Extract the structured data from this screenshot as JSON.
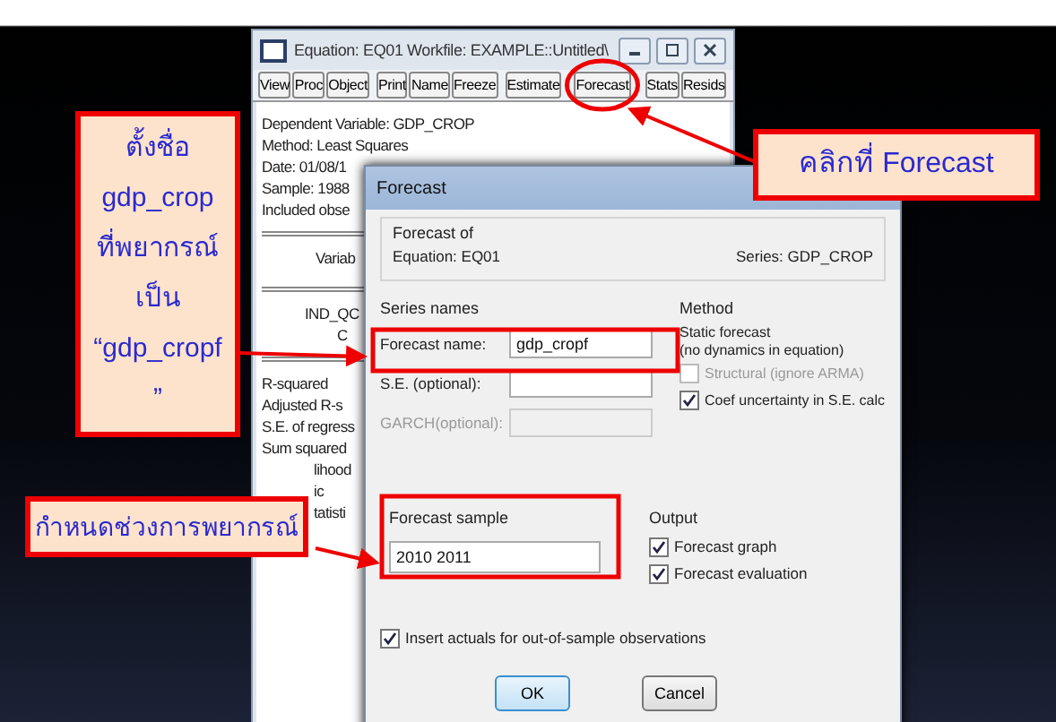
{
  "equation_window": {
    "title": "Equation: EQ01   Workfile: EXAMPLE::Untitled\\",
    "toolbar": [
      {
        "label": "View"
      },
      {
        "label": "Proc"
      },
      {
        "label": "Object"
      },
      {
        "label": "Print"
      },
      {
        "label": "Name"
      },
      {
        "label": "Freeze"
      },
      {
        "label": "Estimate"
      },
      {
        "label": "Forecast"
      },
      {
        "label": "Stats"
      },
      {
        "label": "Resids"
      }
    ],
    "header_lines": [
      "Dependent Variable: GDP_CROP",
      "Method: Least Squares",
      "Date: 01/08/1",
      "Sample: 1988",
      "Included obse"
    ],
    "column_heading": "Variab",
    "rows": [
      "IND_QC",
      "C"
    ],
    "stats": [
      "R-squared",
      "Adjusted R-s",
      "S.E. of regress",
      "Sum squared",
      "lihood",
      "ic",
      "tatisti"
    ]
  },
  "forecast_dialog": {
    "title": "Forecast",
    "forecast_of": {
      "label": "Forecast of",
      "equation": "Equation: EQ01",
      "series": "Series: GDP_CROP"
    },
    "series_names": {
      "label": "Series names",
      "fields": [
        {
          "label": "Forecast name:",
          "value": "gdp_cropf",
          "disabled": false
        },
        {
          "label": "S.E. (optional):",
          "disabled": false
        },
        {
          "label": "GARCH(optional):",
          "disabled": true
        }
      ]
    },
    "method": {
      "label": "Method",
      "option": "Static forecast",
      "note": "(no dynamics in equation)",
      "checks": [
        {
          "label": "Structural (ignore ARMA)",
          "checked": false,
          "disabled": true
        },
        {
          "label": "Coef uncertainty in S.E. calc",
          "checked": true,
          "disabled": false
        }
      ]
    },
    "forecast_sample": {
      "label": "Forecast sample",
      "value": "2010 2011"
    },
    "output": {
      "label": "Output",
      "checks": [
        {
          "label": "Forecast graph",
          "checked": true
        },
        {
          "label": "Forecast evaluation",
          "checked": true
        }
      ]
    },
    "insert_actuals": {
      "label": "Insert actuals for out-of-sample observations",
      "checked": true
    },
    "buttons": [
      "OK",
      "Cancel"
    ]
  },
  "callouts": [
    {
      "text": "ตั้งชื่อ gdp_crop ที่พยากรณ์เป็น “gdp_cropf ”"
    },
    {
      "text": "คลิกที่ Forecast"
    },
    {
      "text": "กำหนดช่วงการพยากรณ์"
    }
  ]
}
